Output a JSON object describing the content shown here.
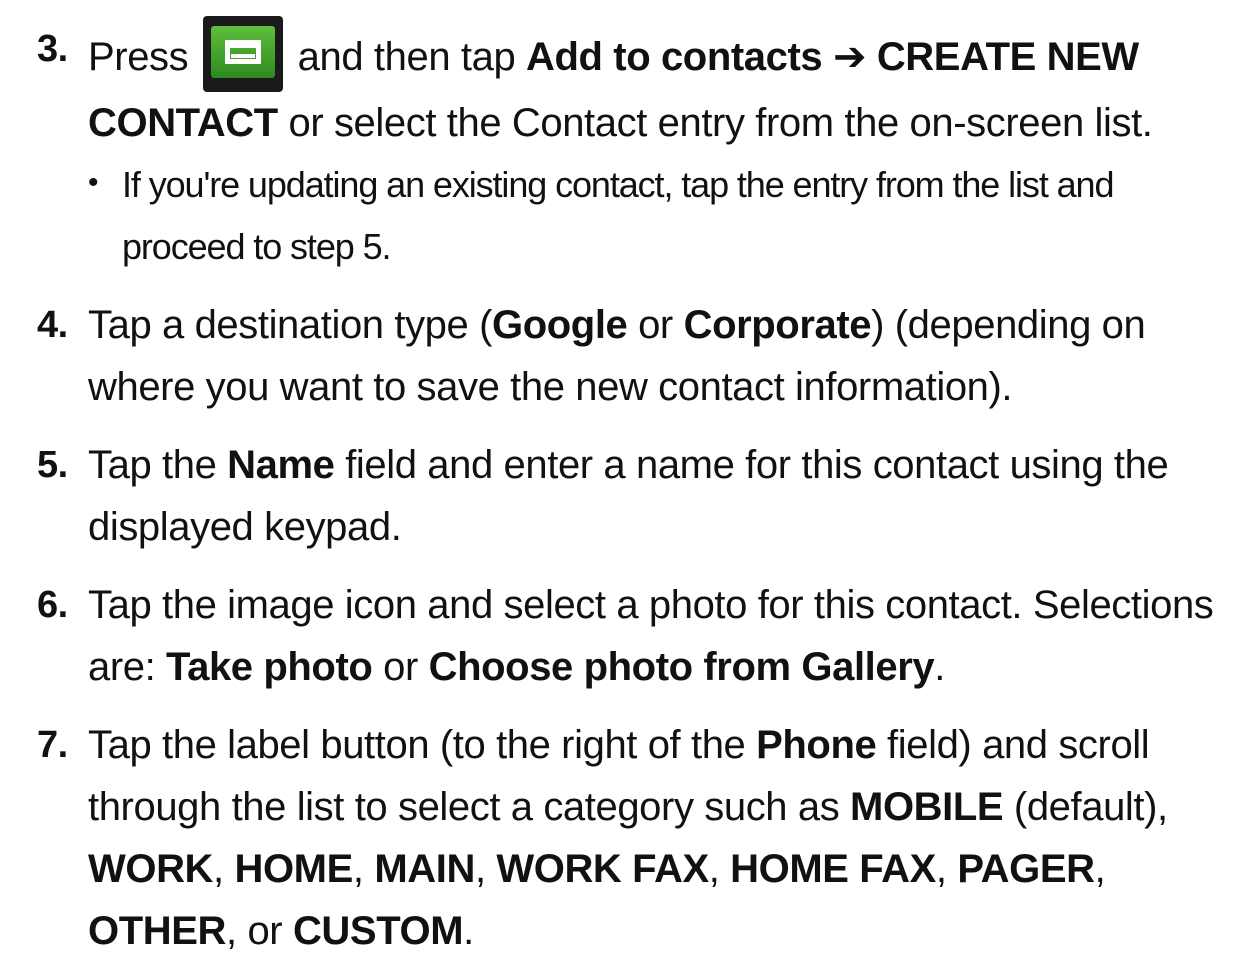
{
  "steps": [
    {
      "number": "3.",
      "parts": [
        "Press ",
        "[menu-key]",
        " and then tap ",
        "**Add to contacts",
        " ➔ ",
        "**CREATE NEW CONTACT",
        " or select the Contact entry from the on-screen list."
      ],
      "bullet": {
        "marker": "•",
        "text": "If you're updating an existing contact, tap the entry from the list and proceed to step 5."
      }
    },
    {
      "number": "4.",
      "parts": [
        "Tap a destination type (",
        "**Google",
        " or ",
        "**Corporate",
        ") (depending on where you want to save the new contact information)."
      ]
    },
    {
      "number": "5.",
      "parts": [
        "Tap the ",
        "**Name",
        " field and enter a name for this contact using the displayed keypad."
      ]
    },
    {
      "number": "6.",
      "parts": [
        "Tap the image icon and select a photo for this contact. Selections are: ",
        "**Take photo",
        " or ",
        "**Choose photo from Gallery",
        "."
      ]
    },
    {
      "number": "7.",
      "parts": [
        "Tap the label button (to the right of the ",
        "**Phone",
        " field) and scroll through the list to select a category such as ",
        "**MOBILE",
        " (default), ",
        "**WORK",
        ", ",
        "**HOME",
        ", ",
        "**MAIN",
        ", ",
        "**WORK FAX",
        ", ",
        "**HOME FAX",
        ", ",
        "**PAGER",
        ", ",
        "**OTHER",
        ", or ",
        "**CUSTOM",
        "."
      ]
    }
  ],
  "icons": {
    "menu_key": "menu-key-icon"
  }
}
